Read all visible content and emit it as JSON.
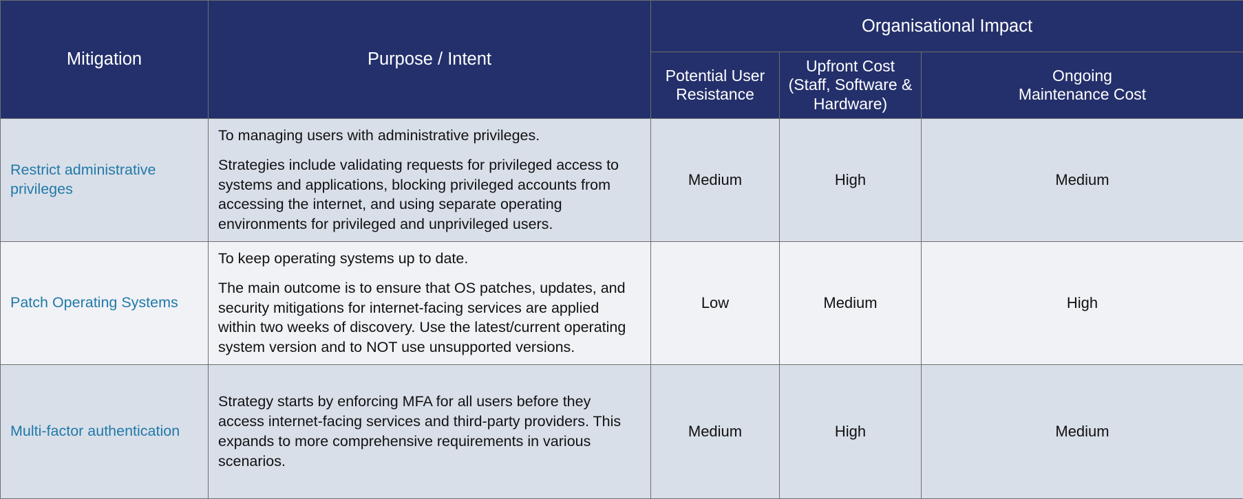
{
  "table": {
    "headers": {
      "mitigation": "Mitigation",
      "purpose": "Purpose / Intent",
      "group": "Organisational Impact",
      "sub": [
        "Potential User Resistance",
        "Upfront Cost (Staff, Software & Hardware)",
        "Ongoing Maintenance Cost"
      ],
      "sub_lines": {
        "resistance": [
          "Potential User",
          "Resistance"
        ],
        "upfront": [
          "Upfront Cost",
          "(Staff, Software &",
          "Hardware)"
        ],
        "ongoing": [
          "Ongoing",
          "Maintenance Cost"
        ]
      }
    },
    "rows": [
      {
        "mitigation": "Restrict administrative privileges",
        "purpose_paragraphs": [
          "To managing users with administrative privileges.",
          "Strategies include validating requests for privileged access to systems and applications, blocking privileged accounts from accessing the internet, and using separate operating environments for privileged and unprivileged users."
        ],
        "potential_user_resistance": "Medium",
        "upfront_cost": "High",
        "ongoing_maintenance_cost": "Medium"
      },
      {
        "mitigation": "Patch Operating Systems",
        "purpose_paragraphs": [
          "To keep operating systems up to date.",
          "The main outcome is to ensure that OS patches, updates, and security mitigations for internet-facing services are applied within two weeks of discovery. Use the latest/current operating system version and to NOT use unsupported versions."
        ],
        "potential_user_resistance": "Low",
        "upfront_cost": "Medium",
        "ongoing_maintenance_cost": "High"
      },
      {
        "mitigation": "Multi-factor authentication",
        "purpose_paragraphs": [
          "Strategy starts by enforcing MFA for all users before they access internet-facing services and third-party providers. This expands to more comprehensive requirements in various scenarios."
        ],
        "potential_user_resistance": "Medium",
        "upfront_cost": "High",
        "ongoing_maintenance_cost": "Medium"
      }
    ]
  },
  "colors": {
    "header_bg": "#24306b",
    "header_text": "#ffffff",
    "row_shaded": "#d9dfe9",
    "row_light": "#f1f2f6",
    "link_text": "#2079a8",
    "border": "#6e6e6e"
  }
}
